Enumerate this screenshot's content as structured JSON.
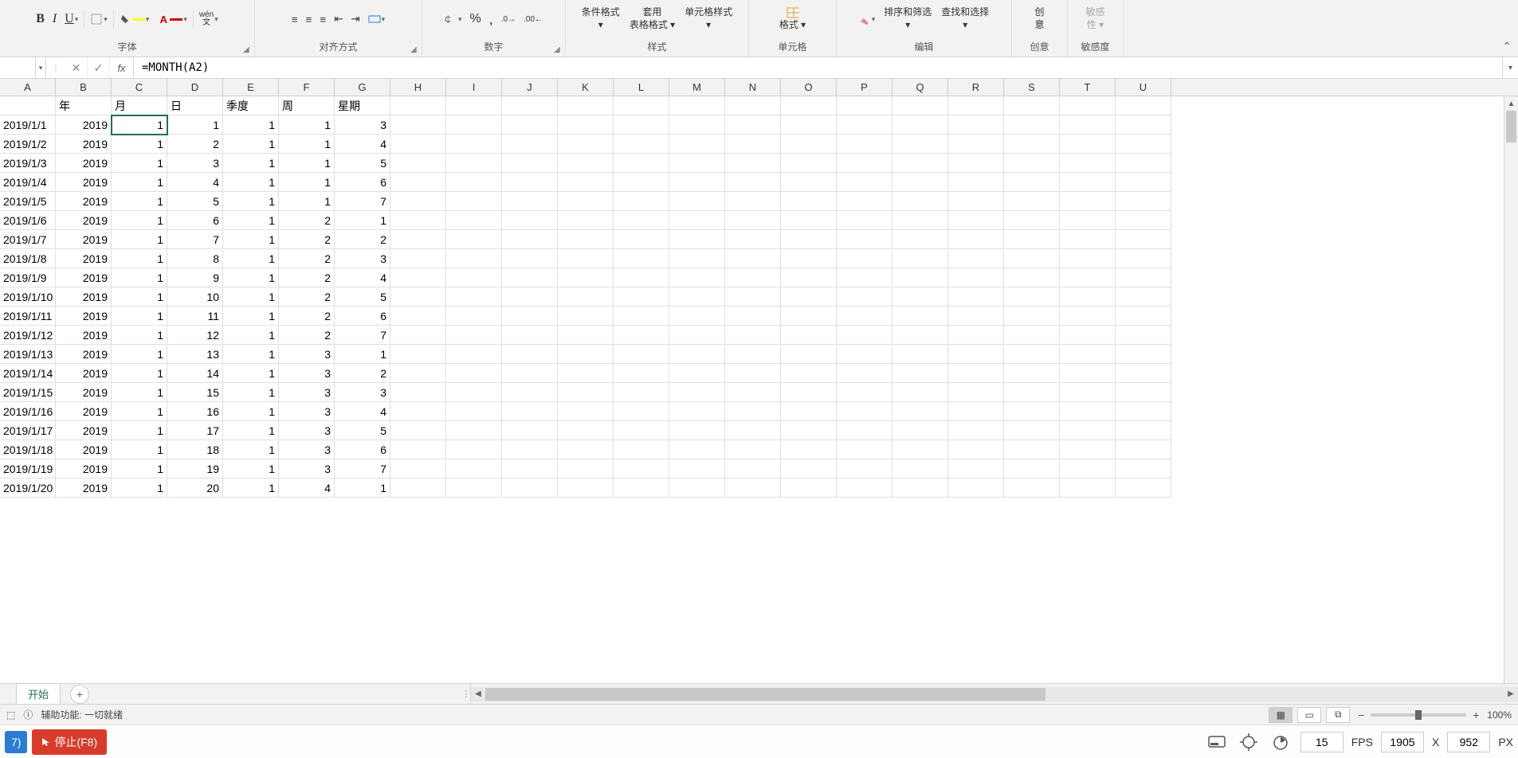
{
  "ribbon": {
    "groups": {
      "font": "字体",
      "alignment": "对齐方式",
      "number": "数字",
      "styles": "样式",
      "cells": "单元格",
      "editing": "编辑",
      "ideas": "创意",
      "sensitivity": "敏感度"
    },
    "buttons": {
      "bold": "B",
      "italic": "I",
      "underline": "U",
      "pinyin": "wén",
      "cond_format": "条件格式",
      "cell_styles": "单元格样式",
      "table_format_top": "套用",
      "table_format_bottom": "表格格式",
      "cell_format": "格式",
      "sort_filter": "排序和筛选",
      "find_select": "查找和选择",
      "ideas_top": "创",
      "ideas_bottom": "意",
      "sens_top": "敏感",
      "sens_bottom": "性"
    }
  },
  "formula_bar": {
    "name_box": "",
    "formula": "=MONTH(A2)"
  },
  "columns": [
    "A",
    "B",
    "C",
    "D",
    "E",
    "F",
    "G",
    "H",
    "I",
    "J",
    "K",
    "L",
    "M",
    "N",
    "O",
    "P",
    "Q",
    "R",
    "S",
    "T",
    "U"
  ],
  "header_row": [
    "",
    "年",
    "月",
    "日",
    "季度",
    "周",
    "星期"
  ],
  "rows": [
    [
      "2019/1/1",
      "2019",
      "1",
      "1",
      "1",
      "1",
      "3"
    ],
    [
      "2019/1/2",
      "2019",
      "1",
      "2",
      "1",
      "1",
      "4"
    ],
    [
      "2019/1/3",
      "2019",
      "1",
      "3",
      "1",
      "1",
      "5"
    ],
    [
      "2019/1/4",
      "2019",
      "1",
      "4",
      "1",
      "1",
      "6"
    ],
    [
      "2019/1/5",
      "2019",
      "1",
      "5",
      "1",
      "1",
      "7"
    ],
    [
      "2019/1/6",
      "2019",
      "1",
      "6",
      "1",
      "2",
      "1"
    ],
    [
      "2019/1/7",
      "2019",
      "1",
      "7",
      "1",
      "2",
      "2"
    ],
    [
      "2019/1/8",
      "2019",
      "1",
      "8",
      "1",
      "2",
      "3"
    ],
    [
      "2019/1/9",
      "2019",
      "1",
      "9",
      "1",
      "2",
      "4"
    ],
    [
      "2019/1/10",
      "2019",
      "1",
      "10",
      "1",
      "2",
      "5"
    ],
    [
      "2019/1/11",
      "2019",
      "1",
      "11",
      "1",
      "2",
      "6"
    ],
    [
      "2019/1/12",
      "2019",
      "1",
      "12",
      "1",
      "2",
      "7"
    ],
    [
      "2019/1/13",
      "2019",
      "1",
      "13",
      "1",
      "3",
      "1"
    ],
    [
      "2019/1/14",
      "2019",
      "1",
      "14",
      "1",
      "3",
      "2"
    ],
    [
      "2019/1/15",
      "2019",
      "1",
      "15",
      "1",
      "3",
      "3"
    ],
    [
      "2019/1/16",
      "2019",
      "1",
      "16",
      "1",
      "3",
      "4"
    ],
    [
      "2019/1/17",
      "2019",
      "1",
      "17",
      "1",
      "3",
      "5"
    ],
    [
      "2019/1/18",
      "2019",
      "1",
      "18",
      "1",
      "3",
      "6"
    ],
    [
      "2019/1/19",
      "2019",
      "1",
      "19",
      "1",
      "3",
      "7"
    ],
    [
      "2019/1/20",
      "2019",
      "1",
      "20",
      "1",
      "4",
      "1"
    ]
  ],
  "sheet": {
    "tab1": "开始"
  },
  "status": {
    "accessibility": "辅助功能: 一切就绪",
    "zoom": "100%"
  },
  "recorder": {
    "left_btn": "7)",
    "stop": "停止(F8)",
    "fps_value": "15",
    "fps_label": "FPS",
    "width": "1905",
    "x": "X",
    "height": "952",
    "px": "PX"
  }
}
